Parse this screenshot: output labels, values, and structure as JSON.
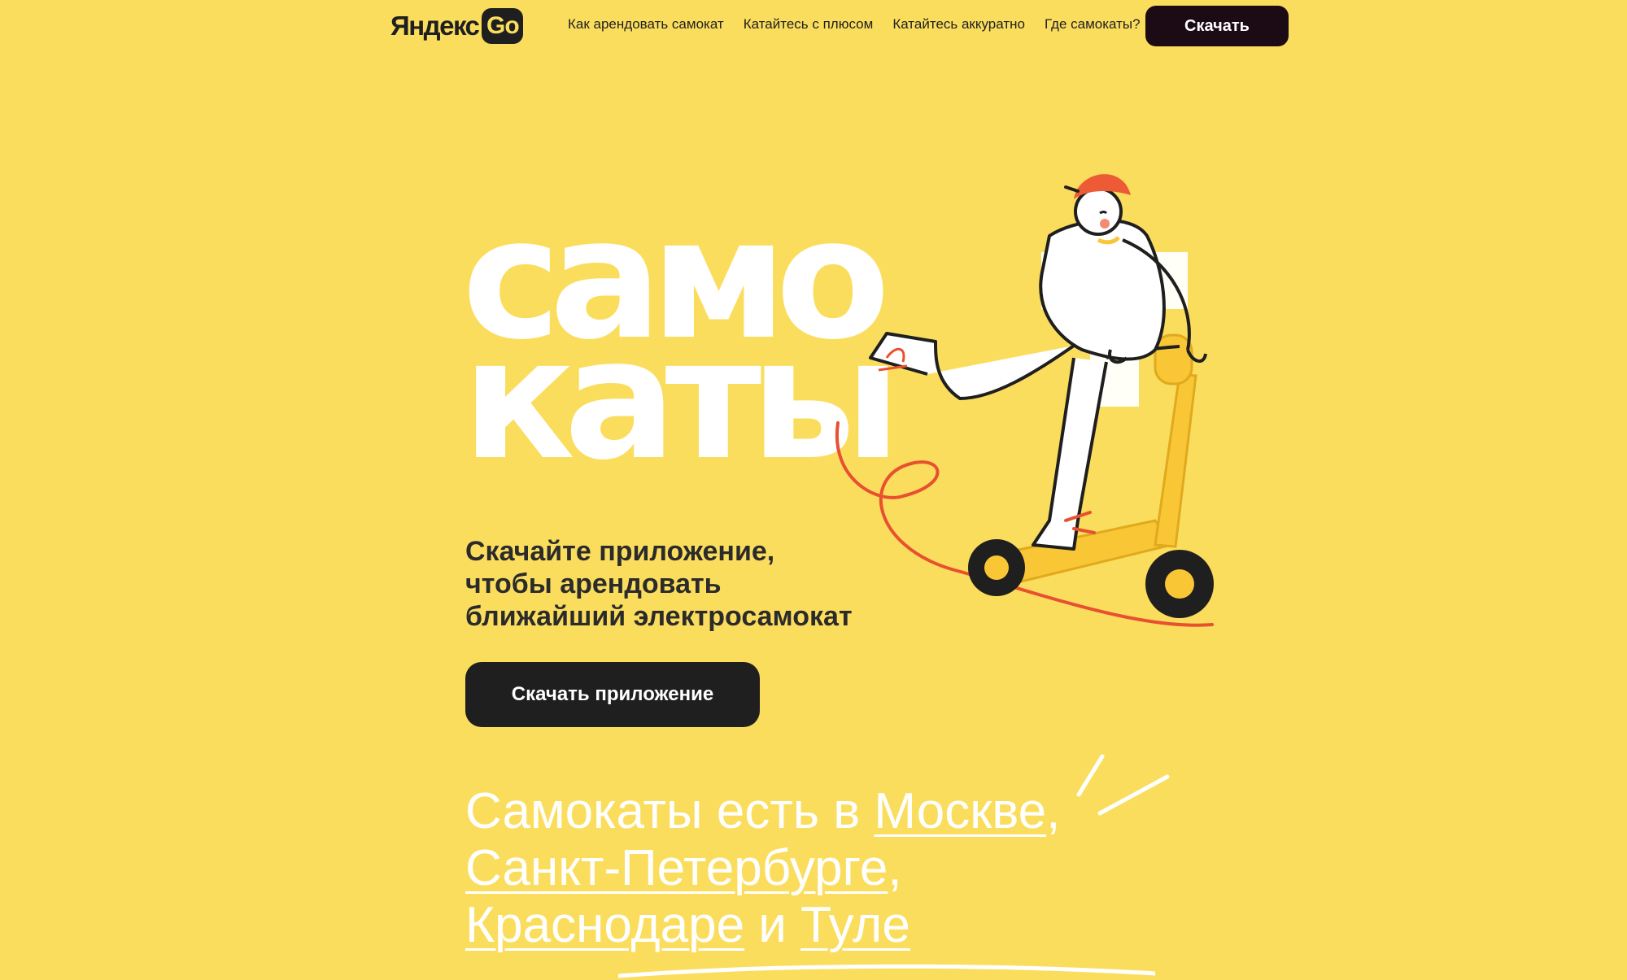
{
  "header": {
    "logo_text": "Яндекс",
    "logo_badge": "Go",
    "nav": [
      "Как арендовать самокат",
      "Катайтесь с плюсом",
      "Катайтесь аккуратно",
      "Где самокаты?"
    ],
    "download_label": "Скачать"
  },
  "hero": {
    "title_line1": "само",
    "title_line2": "каты",
    "subtitle_line1": "Скачайте приложение,",
    "subtitle_line2": "чтобы арендовать",
    "subtitle_line3": "ближайший электросамокат",
    "cta_label": "Скачать приложение"
  },
  "cities": {
    "prefix": "Самокаты есть в ",
    "city1": "Москве",
    "sep1": ",",
    "city2": "Санкт-Петербурге",
    "sep2": ",",
    "city3": "Краснодаре",
    "conj": " и ",
    "city4": "Туле"
  },
  "colors": {
    "background": "#fbdd5e",
    "header_button": "#1c0a14",
    "cta_button": "#1f1f1f",
    "helmet": "#ec5a36",
    "scooter": "#f9c735",
    "cord": "#e8512f"
  },
  "icons": {
    "illustration": "scooter-rider-illustration",
    "sparks": "sparkle-lines-icon"
  }
}
